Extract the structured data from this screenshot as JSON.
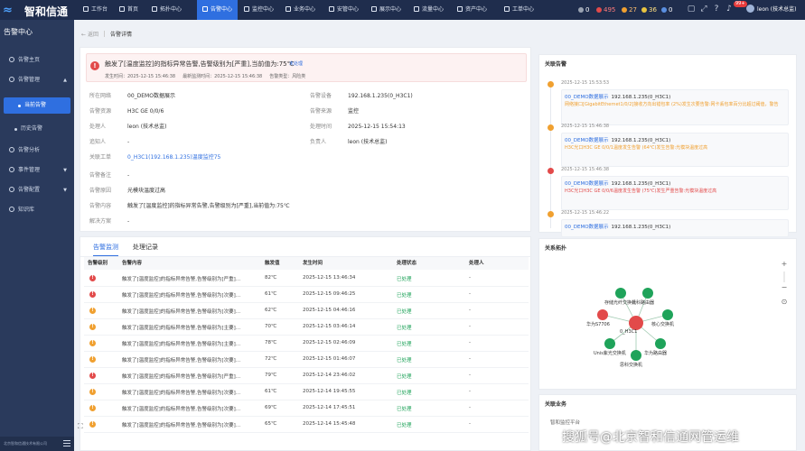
{
  "app": {
    "logo_mark": "≈",
    "logo_text": "智和信通"
  },
  "nav": [
    {
      "label": "工作台"
    },
    {
      "label": "首页"
    },
    {
      "label": "拓扑中心"
    },
    {
      "label": "告警中心"
    },
    {
      "label": "监控中心"
    },
    {
      "label": "业务中心"
    },
    {
      "label": "安管中心"
    },
    {
      "label": "展示中心"
    },
    {
      "label": "流量中心"
    },
    {
      "label": "资产中心"
    },
    {
      "label": "工单中心"
    }
  ],
  "counters": [
    {
      "value": "0",
      "color": "#9aa3b2"
    },
    {
      "value": "495",
      "color": "#e24a4a"
    },
    {
      "value": "27",
      "color": "#f0a030"
    },
    {
      "value": "36",
      "color": "#e8c340"
    },
    {
      "value": "0",
      "color": "#5a8fe0"
    }
  ],
  "topbar": {
    "badge": "99+",
    "user": "leon (技术总监)"
  },
  "sidebar": {
    "title": "告警中心",
    "items": [
      {
        "label": "告警主页"
      },
      {
        "label": "告警管理"
      },
      {
        "label": "当前告警"
      },
      {
        "label": "历史告警"
      },
      {
        "label": "告警分析"
      },
      {
        "label": "事件管理"
      },
      {
        "label": "告警配置"
      },
      {
        "label": "知识库"
      }
    ],
    "footer": "北京智和信通技术有限公司"
  },
  "breadcrumb": {
    "back": "返回",
    "current": "告警详情"
  },
  "alarm": {
    "title": "触发了[温度监控]的指标异常告警,告警级别为[严重],当前值为:75℃",
    "tag": "未处理",
    "meta": {
      "occur": "发生时间：2025-12-15 15:46:38",
      "last": "最新监测时间：2025-12-15 15:46:38",
      "type": "告警类型：风险类"
    }
  },
  "fields": {
    "net_label": "所在网络",
    "net": "00_DEMO数据展示",
    "device_label": "告警设备",
    "device": "192.168.1.235(0_H3C1)",
    "res_label": "告警资源",
    "res": "H3C GE 0/0/6",
    "source_label": "告警来源",
    "source": "监控",
    "handler_label": "处理人",
    "handler": "leon (技术总监)",
    "handle_time_label": "处理时间",
    "handle_time": "2025-12-15 15:54:13",
    "cc_label": "追知人",
    "cc": "-",
    "owner_label": "负责人",
    "owner": "leon (技术总监)",
    "order_label": "关联工单",
    "order": "0_H3C1(192.168.1.235)温度监控75",
    "note_label": "告警备注",
    "note": "-",
    "cause_label": "告警原因",
    "cause": "光模块温度过高",
    "content_label": "告警内容",
    "content": "触发了[温度监控]的指标异常告警,告警级别为[严重],当前值为:75℃",
    "solution_label": "解决方案",
    "solution": "-"
  },
  "records": {
    "tabs": [
      {
        "label": "告警监测"
      },
      {
        "label": "处理记录"
      }
    ],
    "headers": {
      "level": "告警级别",
      "content": "告警内容",
      "value": "触发值",
      "time": "发生时间",
      "status": "处理状态",
      "handler": "处理人"
    },
    "rows": [
      {
        "level_color": "#e24a4a",
        "content": "触发了[温度监控]的指标异常告警,告警级别为[严重]...",
        "value": "82℃",
        "time": "2025-12-15 13:46:34",
        "status": "已处理",
        "handler": "-"
      },
      {
        "level_color": "#e24a4a",
        "content": "触发了[温度监控]的指标异常告警,告警级别为[次要]...",
        "value": "61℃",
        "time": "2025-12-15 09:46:25",
        "status": "已处理",
        "handler": "-"
      },
      {
        "level_color": "#f0a030",
        "content": "触发了[温度监控]的指标异常告警,告警级别为[次要]...",
        "value": "62℃",
        "time": "2025-12-15 04:46:16",
        "status": "已处理",
        "handler": "-"
      },
      {
        "level_color": "#f0a030",
        "content": "触发了[温度监控]的指标异常告警,告警级别为[主要]...",
        "value": "70℃",
        "time": "2025-12-15 03:46:14",
        "status": "已处理",
        "handler": "-"
      },
      {
        "level_color": "#f0a030",
        "content": "触发了[温度监控]的指标异常告警,告警级别为[主要]...",
        "value": "78℃",
        "time": "2025-12-15 02:46:09",
        "status": "已处理",
        "handler": "-"
      },
      {
        "level_color": "#f0a030",
        "content": "触发了[温度监控]的指标异常告警,告警级别为[次要]...",
        "value": "72℃",
        "time": "2025-12-15 01:46:07",
        "status": "已处理",
        "handler": "-"
      },
      {
        "level_color": "#e24a4a",
        "content": "触发了[温度监控]的指标异常告警,告警级别为[严重]...",
        "value": "79℃",
        "time": "2025-12-14 23:46:02",
        "status": "已处理",
        "handler": "-"
      },
      {
        "level_color": "#f0a030",
        "content": "触发了[温度监控]的指标异常告警,告警级别为[次要]...",
        "value": "61℃",
        "time": "2025-12-14 19:45:55",
        "status": "已处理",
        "handler": "-"
      },
      {
        "level_color": "#f0a030",
        "content": "触发了[温度监控]的指标异常告警,告警级别为[次要]...",
        "value": "69℃",
        "time": "2025-12-14 17:45:51",
        "status": "已处理",
        "handler": "-"
      },
      {
        "level_color": "#f0a030",
        "content": "触发了[温度监控]的指标异常告警,告警级别为[次要]...",
        "value": "65℃",
        "time": "2025-12-14 15:45:48",
        "status": "已处理",
        "handler": "-"
      }
    ]
  },
  "related": {
    "title": "关联告警",
    "items": [
      {
        "time": "2025-12-15 15:53:53",
        "tag": "00_DEMO数据展示",
        "device": "192.168.1.235(0_H3C1)",
        "desc": "网络接口[GigabitEthernet1/0/2]接收方向出错包率 (2%)发生次要告警:网卡丢包率百分比超过阈值，警告",
        "color": "#f0a030"
      },
      {
        "time": "2025-12-15 15:46:38",
        "tag": "00_DEMO数据展示",
        "device": "192.168.1.235(0_H3C1)",
        "desc": "H3C光口H3C GE 0/0/1温度发生告警 (64℃)发生告警:光模块温度过高",
        "color": "#f0a030"
      },
      {
        "time": "2025-12-15 15:46:38",
        "tag": "00_DEMO数据展示",
        "device": "192.168.1.235(0_H3C1)",
        "desc": "H3C光口H3C GE 0/0/6温度发生告警 (75℃)发生严重告警:光模块温度过高",
        "color": "#e24a4a"
      },
      {
        "time": "2025-12-15 15:46:22",
        "tag": "00_DEMO数据展示",
        "device": "192.168.1.235(0_H3C1)",
        "desc": "",
        "color": "#f0a030"
      }
    ]
  },
  "topo": {
    "title": "关系拓扑",
    "nodes": [
      {
        "label": "存储光纤交换机",
        "color": "#1fa35a"
      },
      {
        "label": "计科路由器",
        "color": "#1fa35a"
      },
      {
        "label": "华为S7706",
        "color": "#e24a4a"
      },
      {
        "label": "0_H3C1",
        "color": "#e24a4a"
      },
      {
        "label": "核心交换机",
        "color": "#1fa35a"
      },
      {
        "label": "Unis紫光交换机",
        "color": "#1fa35a"
      },
      {
        "label": "华为路由器",
        "color": "#1fa35a"
      },
      {
        "label": "思科交换机",
        "color": "#1fa35a"
      }
    ],
    "zoom_in": "+",
    "zoom_out": "−",
    "fit": "⊙"
  },
  "biz": {
    "title": "关联业务",
    "item": "智和监控平台"
  },
  "watermark": "搜狐号@北京智和信通网管运维"
}
